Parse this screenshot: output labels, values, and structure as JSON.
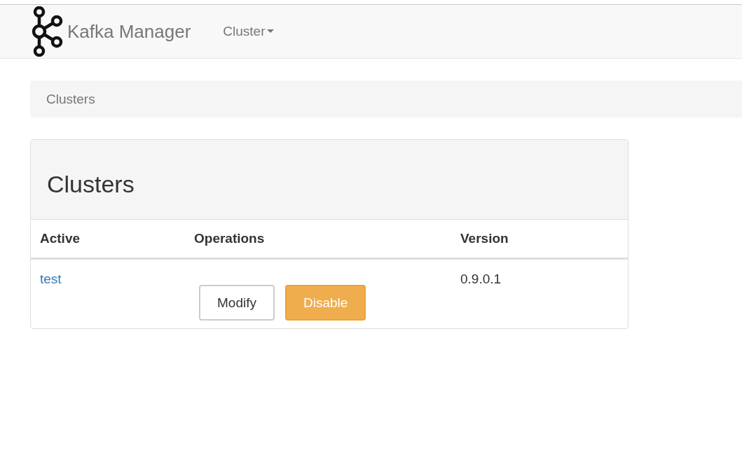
{
  "navbar": {
    "brand": "Kafka Manager",
    "menu": [
      {
        "label": "Cluster"
      }
    ]
  },
  "breadcrumb": [
    "Clusters"
  ],
  "panel": {
    "title": "Clusters",
    "table": {
      "columns": [
        "Active",
        "Operations",
        "Version"
      ],
      "rows": [
        {
          "name": "test",
          "operations": [
            {
              "label": "Modify",
              "kind": "default"
            },
            {
              "label": "Disable",
              "kind": "warning"
            }
          ],
          "version": "0.9.0.1"
        }
      ]
    }
  }
}
